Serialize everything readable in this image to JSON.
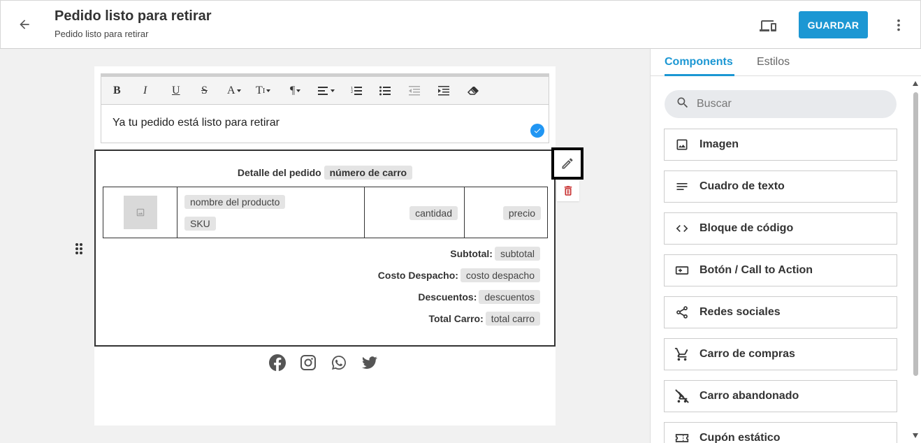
{
  "header": {
    "title": "Pedido listo para retirar",
    "subtitle": "Pedido listo para retirar",
    "save_label": "GUARDAR"
  },
  "editor": {
    "toolbar": {
      "bold": "B",
      "italic": "I",
      "underline": "U",
      "strike": "S",
      "font_color": "A",
      "font_size": "T",
      "paragraph": "¶"
    },
    "text": "Ya tu pedido está listo para retirar"
  },
  "order": {
    "header_label": "Detalle del pedido",
    "header_tag": "número de carro",
    "product_name": "nombre del producto",
    "sku": "SKU",
    "quantity": "cantidad",
    "price": "precio",
    "summary": [
      {
        "label": "Subtotal:",
        "tag": "subtotal"
      },
      {
        "label": "Costo Despacho:",
        "tag": "costo despacho"
      },
      {
        "label": "Descuentos:",
        "tag": "descuentos"
      },
      {
        "label": "Total Carro:",
        "tag": "total carro"
      }
    ]
  },
  "social_icons": [
    "facebook-icon",
    "instagram-icon",
    "whatsapp-icon",
    "twitter-icon"
  ],
  "panel": {
    "tabs": [
      {
        "label": "Components",
        "active": true
      },
      {
        "label": "Estilos",
        "active": false
      }
    ],
    "search_placeholder": "Buscar",
    "components": [
      {
        "label": "Imagen",
        "icon": "image-icon"
      },
      {
        "label": "Cuadro de texto",
        "icon": "text-lines-icon"
      },
      {
        "label": "Bloque de código",
        "icon": "code-icon"
      },
      {
        "label": "Botón / Call to Action",
        "icon": "button-icon"
      },
      {
        "label": "Redes sociales",
        "icon": "share-icon"
      },
      {
        "label": "Carro de compras",
        "icon": "cart-icon"
      },
      {
        "label": "Carro abandonado",
        "icon": "cart-off-icon"
      },
      {
        "label": "Cupón estático",
        "icon": "coupon-icon"
      }
    ]
  },
  "colors": {
    "accent": "#1c97d3",
    "delete": "#c62828",
    "check": "#2196f3"
  }
}
